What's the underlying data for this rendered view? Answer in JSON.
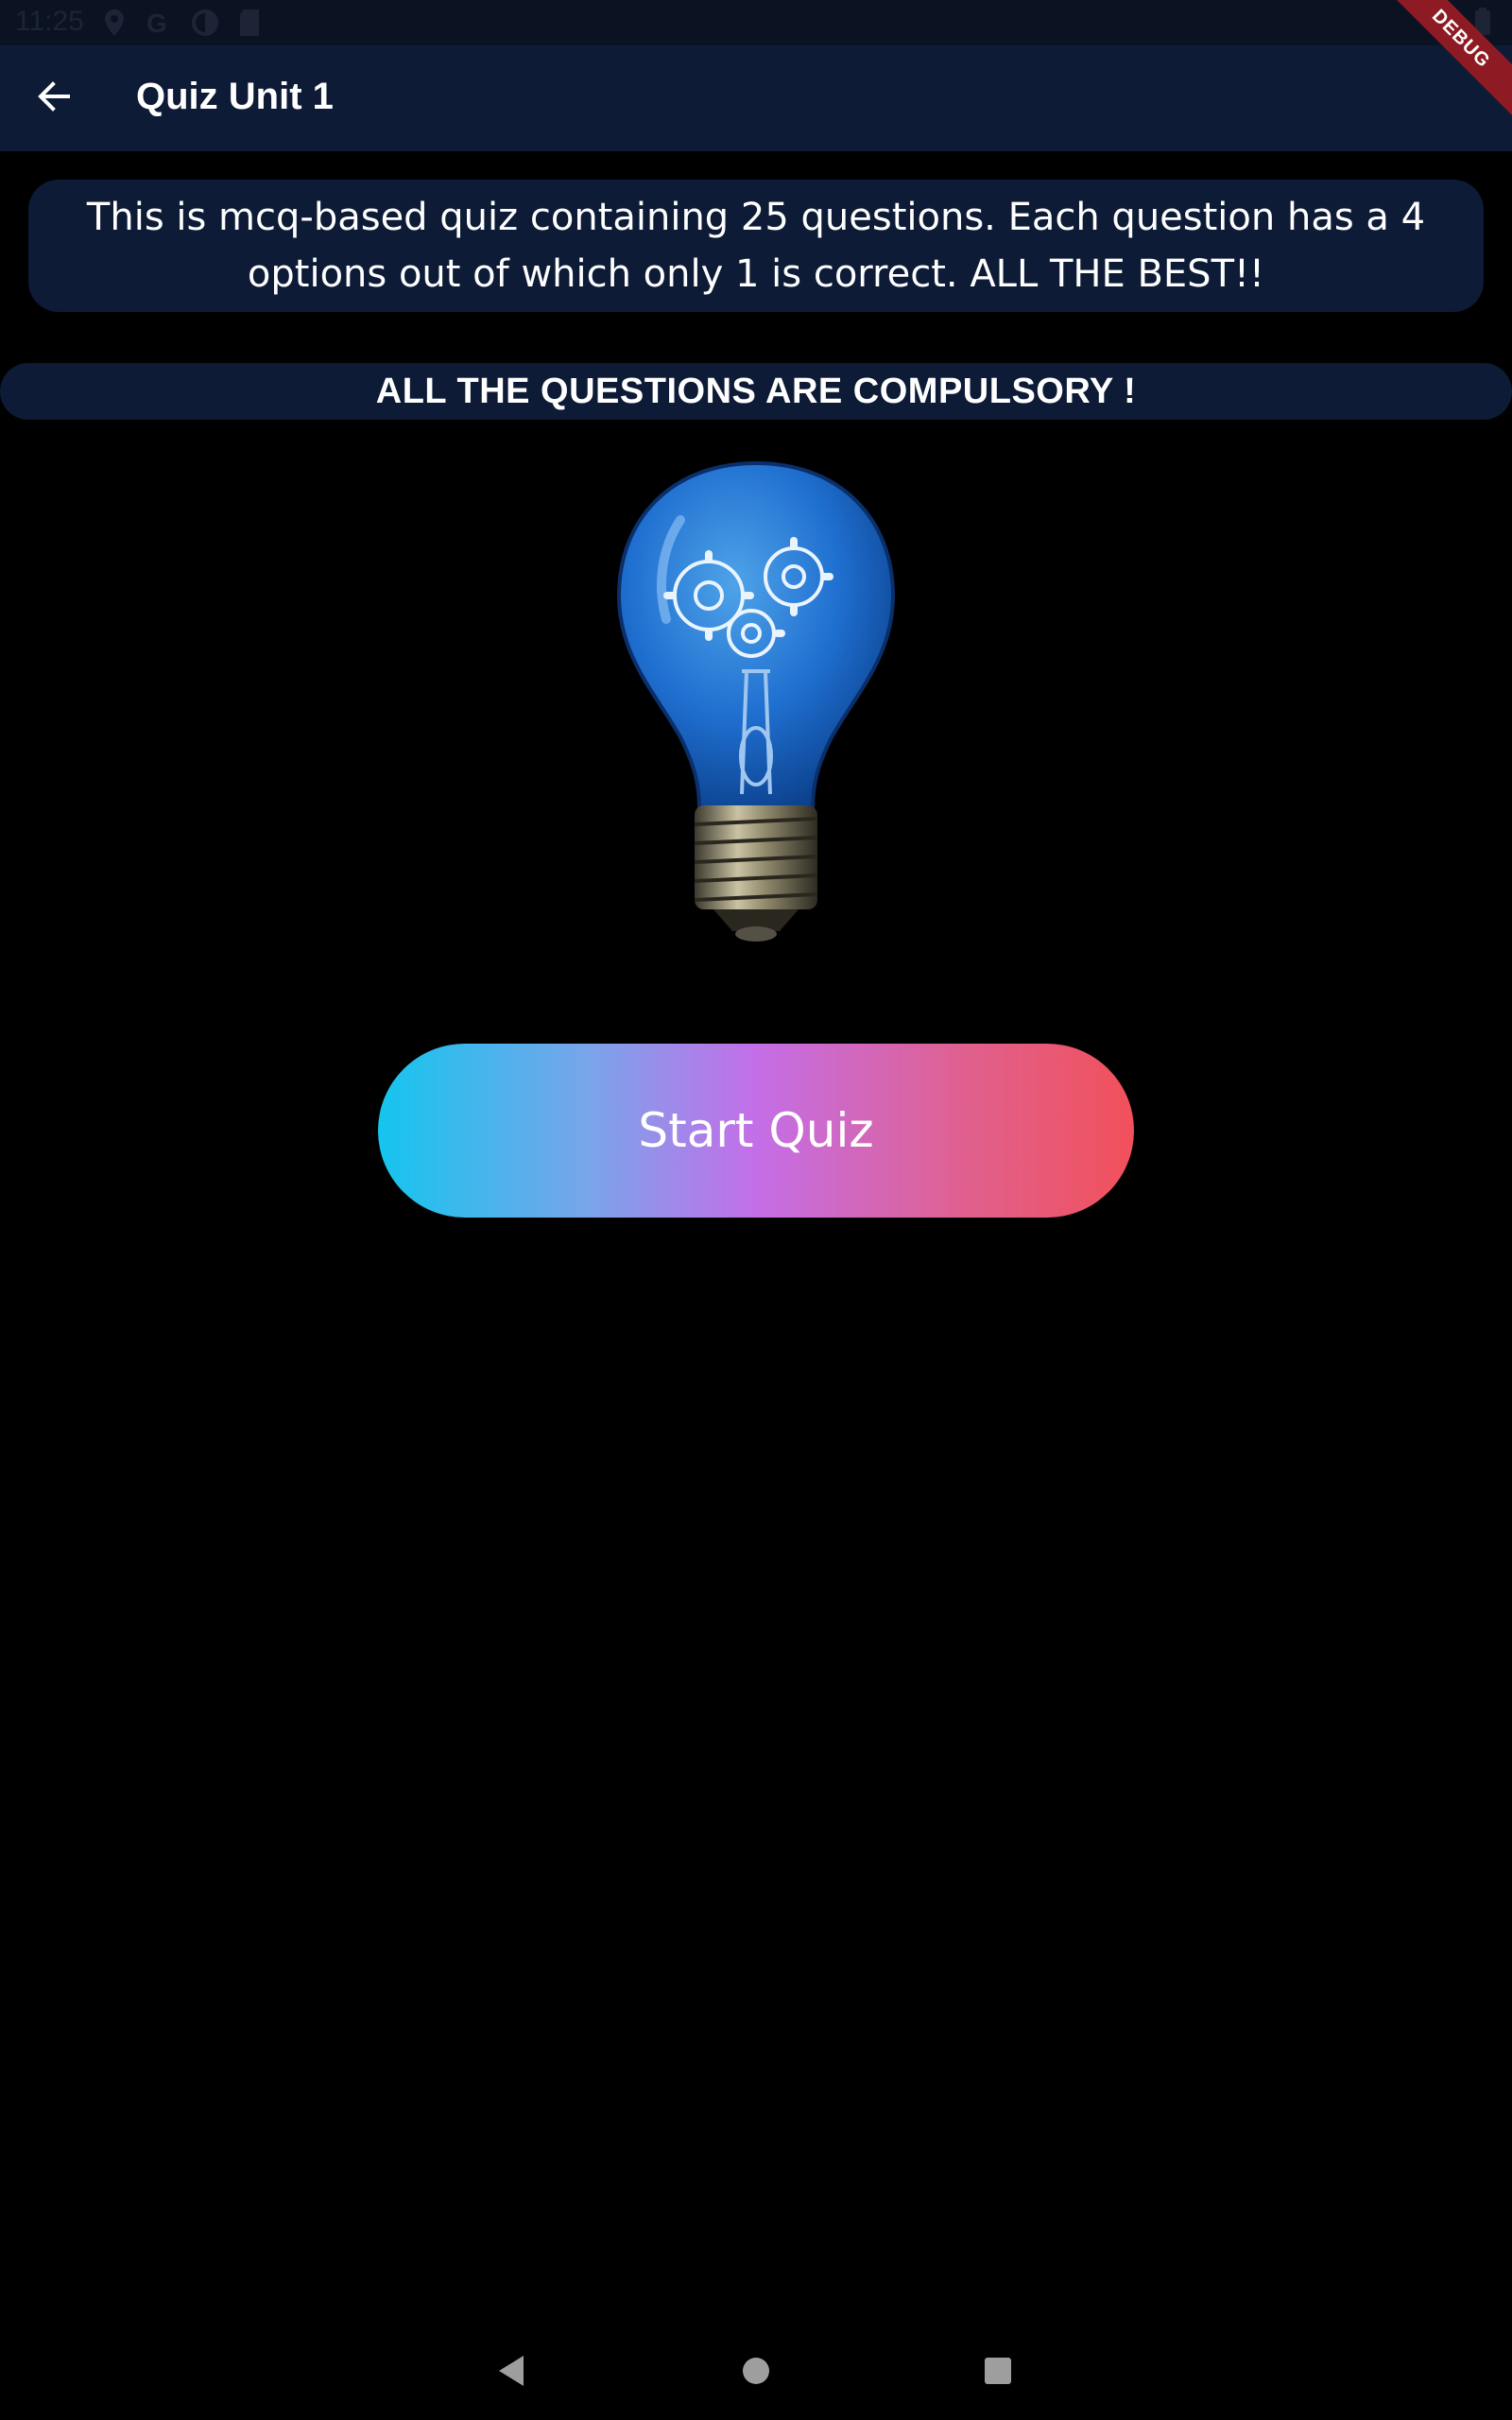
{
  "status_bar": {
    "time": "11:25",
    "left_icons": [
      "location-icon",
      "google-icon",
      "sync-icon",
      "sd-card-icon"
    ],
    "right_icons": [
      "wifi-icon",
      "battery-icon"
    ]
  },
  "app_bar": {
    "back_icon": "arrow-left-icon",
    "title": "Quiz Unit 1",
    "debug_badge": "DEBUG"
  },
  "intro": {
    "text": "This is mcq-based quiz containing 25 questions. Each question has a 4 options out of which only 1 is correct. ALL THE BEST!!"
  },
  "notice": {
    "text": "ALL THE QUESTIONS ARE COMPULSORY !"
  },
  "illustration": {
    "icon": "lightbulb-gears-icon"
  },
  "start_button": {
    "label": "Start Quiz"
  },
  "nav_bar": {
    "buttons": [
      "back-triangle-icon",
      "home-circle-icon",
      "recents-square-icon"
    ]
  },
  "colors": {
    "background": "#000000",
    "app_bar": "#0d1b36",
    "card": "#0d1b36",
    "gradient_start": "#14c5ee",
    "gradient_mid": "#c46ee8",
    "gradient_end": "#f2505a"
  }
}
